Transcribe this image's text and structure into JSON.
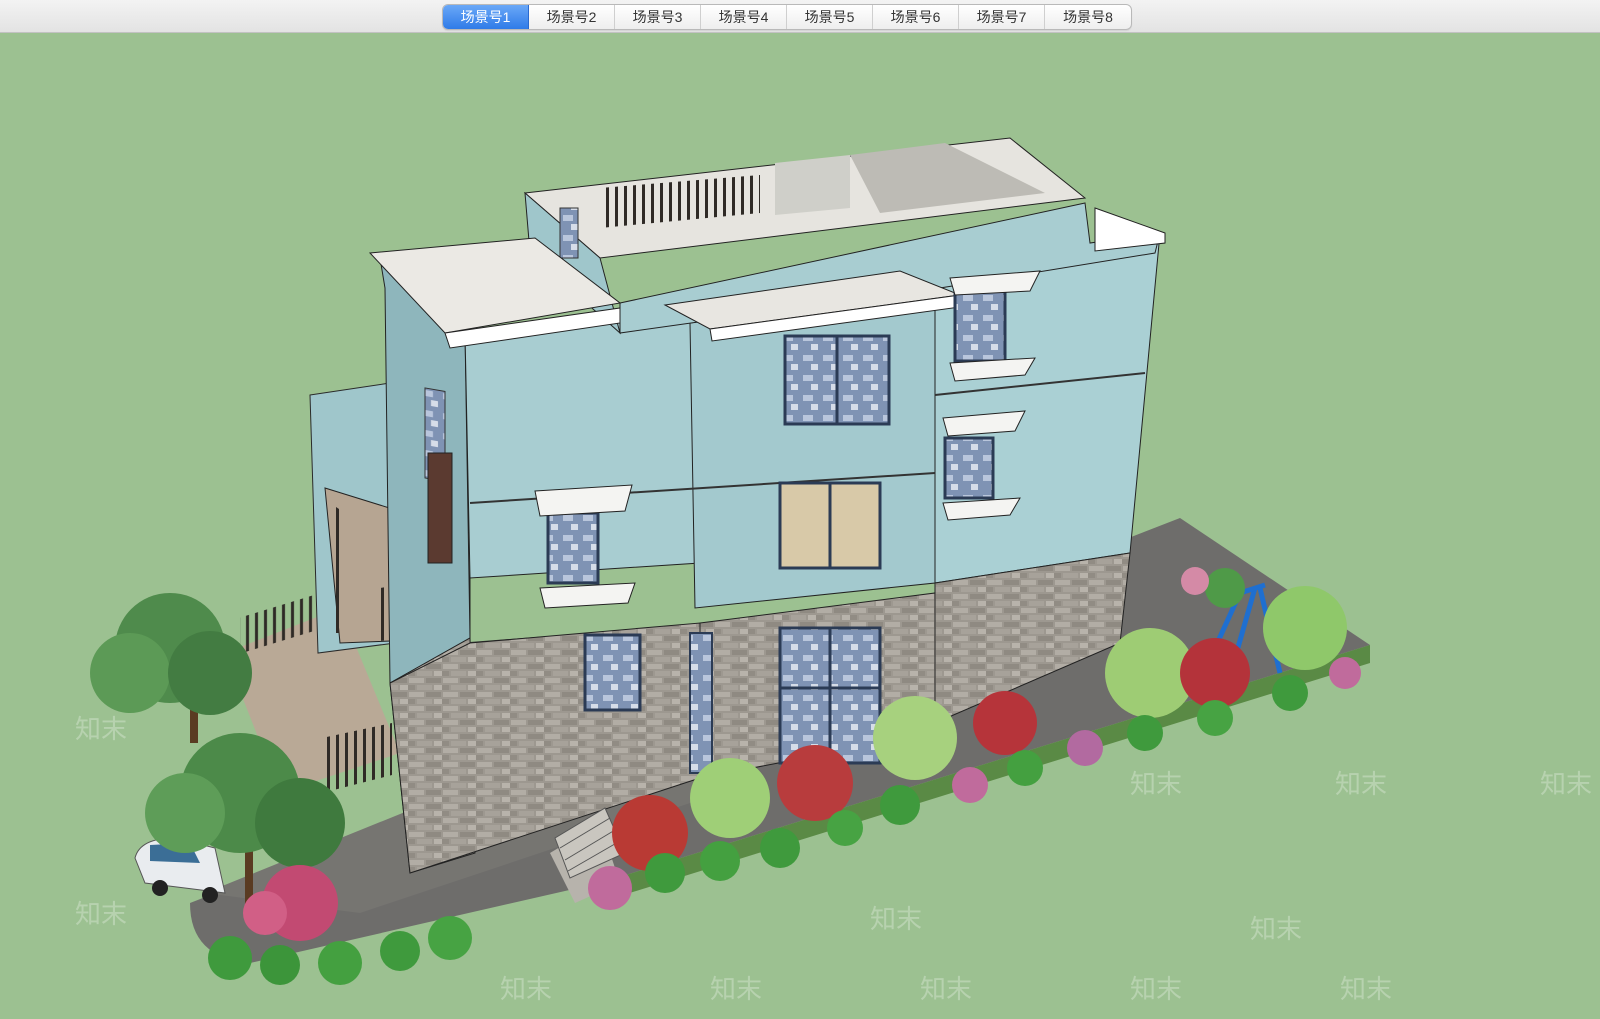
{
  "app": {
    "scene_tabs": [
      {
        "label": "场景号1",
        "active": true
      },
      {
        "label": "场景号2",
        "active": false
      },
      {
        "label": "场景号3",
        "active": false
      },
      {
        "label": "场景号4",
        "active": false
      },
      {
        "label": "场景号5",
        "active": false
      },
      {
        "label": "场景号6",
        "active": false
      },
      {
        "label": "场景号7",
        "active": false
      },
      {
        "label": "场景号8",
        "active": false
      }
    ]
  },
  "watermark": {
    "text": "知末"
  },
  "colors": {
    "ground": "#9cc191",
    "wall": "#a8cdd1",
    "wall_shade": "#8fb7bd",
    "stone": "#9a958c",
    "trim": "#f1f1ee",
    "tab_active": "#2f7be8"
  }
}
